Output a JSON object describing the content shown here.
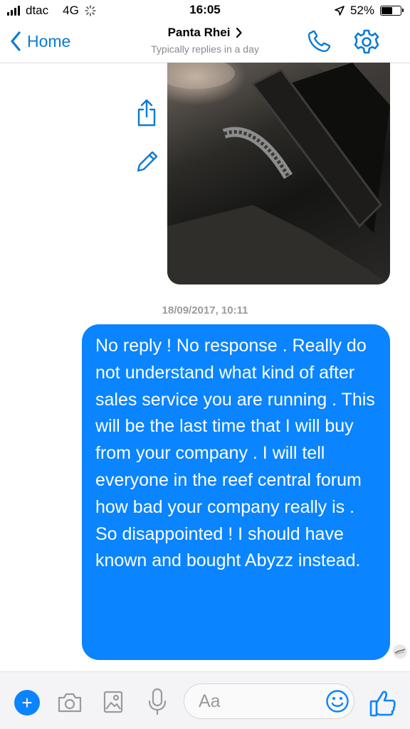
{
  "status_bar": {
    "carrier": "dtac",
    "network": "4G",
    "time": "16:05",
    "battery_percent": "52%",
    "battery_level": 0.52
  },
  "header": {
    "back_label": "Home",
    "title": "Panta Rhei",
    "subtitle": "Typically replies in a day"
  },
  "conversation": {
    "timestamp": "18/09/2017, 10:11",
    "message": "No reply ! No response . Really do not understand what kind of after sales service you are running . This will be the last time that I will buy from your company . I will tell everyone in the reef central forum how bad your company really is . So disappointed ! I should have known and bought Abyzz instead."
  },
  "composer": {
    "placeholder": "Aa"
  },
  "colors": {
    "accent": "#0a84ff",
    "link": "#0a7bd7",
    "timestamp": "#9b9b9b"
  },
  "icons": [
    "signal-icon",
    "loading-icon",
    "location-arrow-icon",
    "battery-icon",
    "chevron-left-icon",
    "chevron-right-icon",
    "phone-icon",
    "gear-icon",
    "share-icon",
    "edit-icon",
    "seen-avatar-icon",
    "plus-icon",
    "camera-icon",
    "gallery-icon",
    "microphone-icon",
    "emoji-icon",
    "thumbs-up-icon"
  ]
}
